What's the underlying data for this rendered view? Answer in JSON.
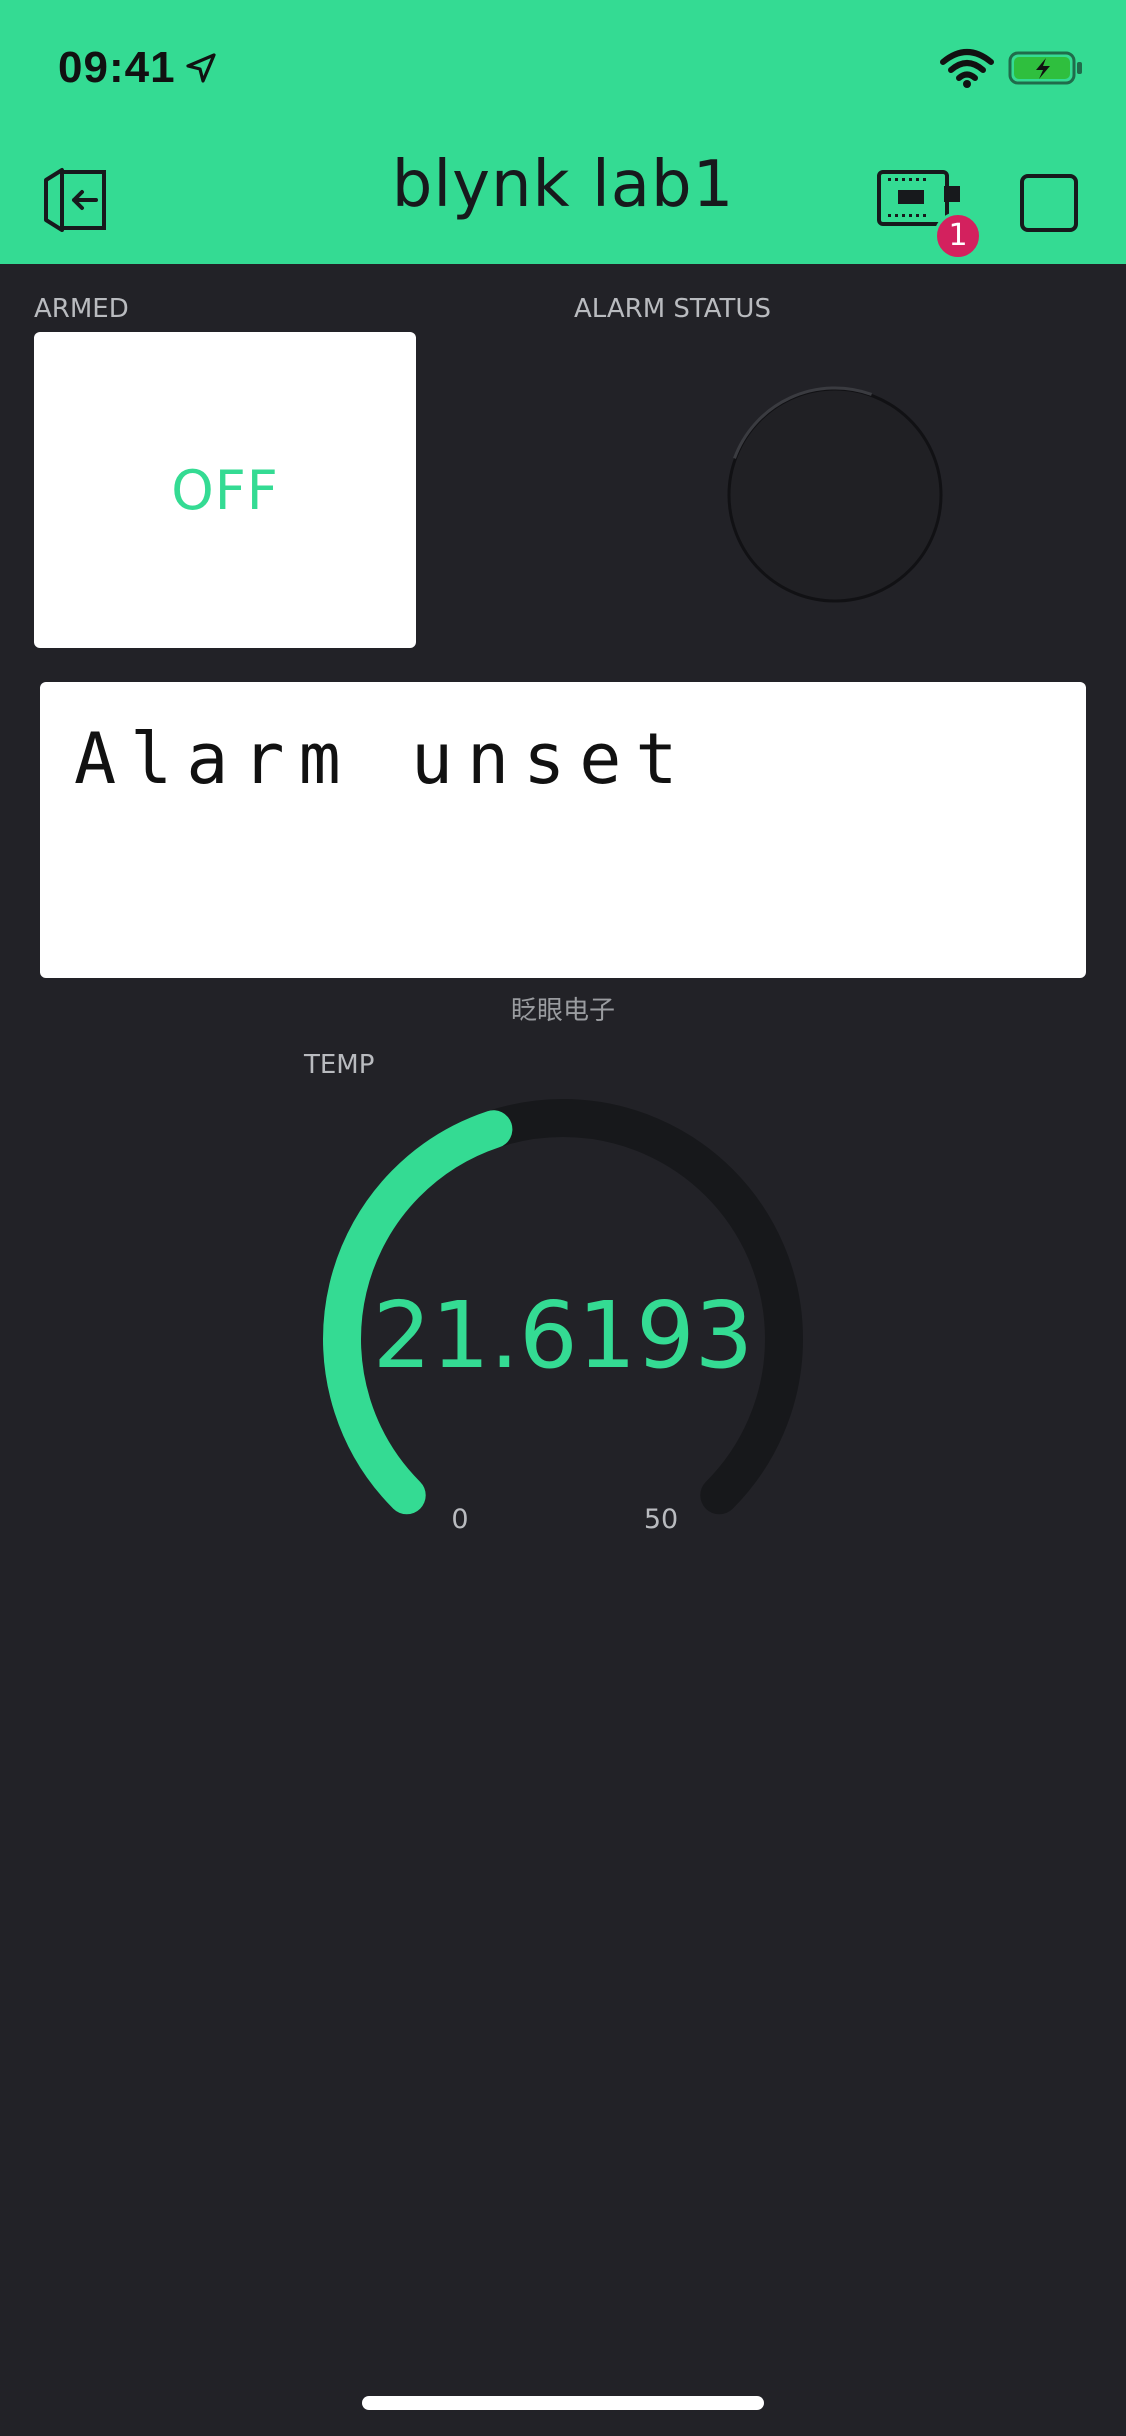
{
  "status_bar": {
    "time": "09:41",
    "icons": [
      "location-arrow-icon",
      "wifi-icon",
      "battery-charging-icon"
    ]
  },
  "header": {
    "title": "blynk lab1",
    "back_icon": "exit-project-icon",
    "device_icon": "device-board-icon",
    "device_badge": "1",
    "stop_icon": "stop-square-icon",
    "background_color": "#34db93"
  },
  "widgets": {
    "armed": {
      "label": "ARMED",
      "state": "OFF",
      "text_color": "#34db93"
    },
    "alarm_status": {
      "label": "ALARM STATUS",
      "led_state": "off"
    },
    "lcd": {
      "line1": "Alarm unset",
      "line2": "",
      "caption": "眨眼电子"
    },
    "temp_gauge": {
      "label": "TEMP",
      "value": "21.6193",
      "min": "0",
      "max": "50",
      "fill_fraction": 0.432,
      "accent_color": "#34db93"
    }
  },
  "colors": {
    "background": "#222227",
    "accent": "#34db93",
    "badge": "#d3215e"
  }
}
